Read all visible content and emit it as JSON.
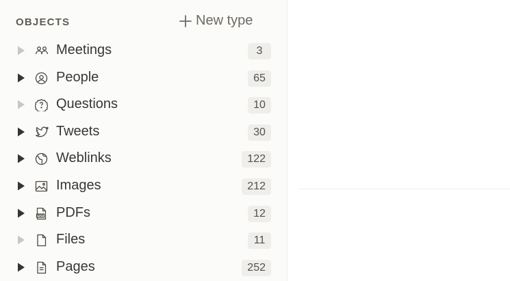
{
  "sidebar": {
    "section_title": "OBJECTS",
    "new_type_label": "New type",
    "items": [
      {
        "label": "Meetings",
        "count": "3",
        "icon": "meetings-icon",
        "expandable": false
      },
      {
        "label": "People",
        "count": "65",
        "icon": "person-icon",
        "expandable": true
      },
      {
        "label": "Questions",
        "count": "10",
        "icon": "question-icon",
        "expandable": false
      },
      {
        "label": "Tweets",
        "count": "30",
        "icon": "twitter-icon",
        "expandable": true
      },
      {
        "label": "Weblinks",
        "count": "122",
        "icon": "globe-icon",
        "expandable": true
      },
      {
        "label": "Images",
        "count": "212",
        "icon": "image-icon",
        "expandable": true
      },
      {
        "label": "PDFs",
        "count": "12",
        "icon": "pdf-icon",
        "expandable": true
      },
      {
        "label": "Files",
        "count": "11",
        "icon": "file-icon",
        "expandable": false
      },
      {
        "label": "Pages",
        "count": "252",
        "icon": "page-icon",
        "expandable": true
      }
    ]
  },
  "colors": {
    "sidebar_bg": "#fbfbfa",
    "caret_active": "#37352f",
    "caret_inactive": "#c9c7c2",
    "badge_bg": "#efeeeb"
  }
}
